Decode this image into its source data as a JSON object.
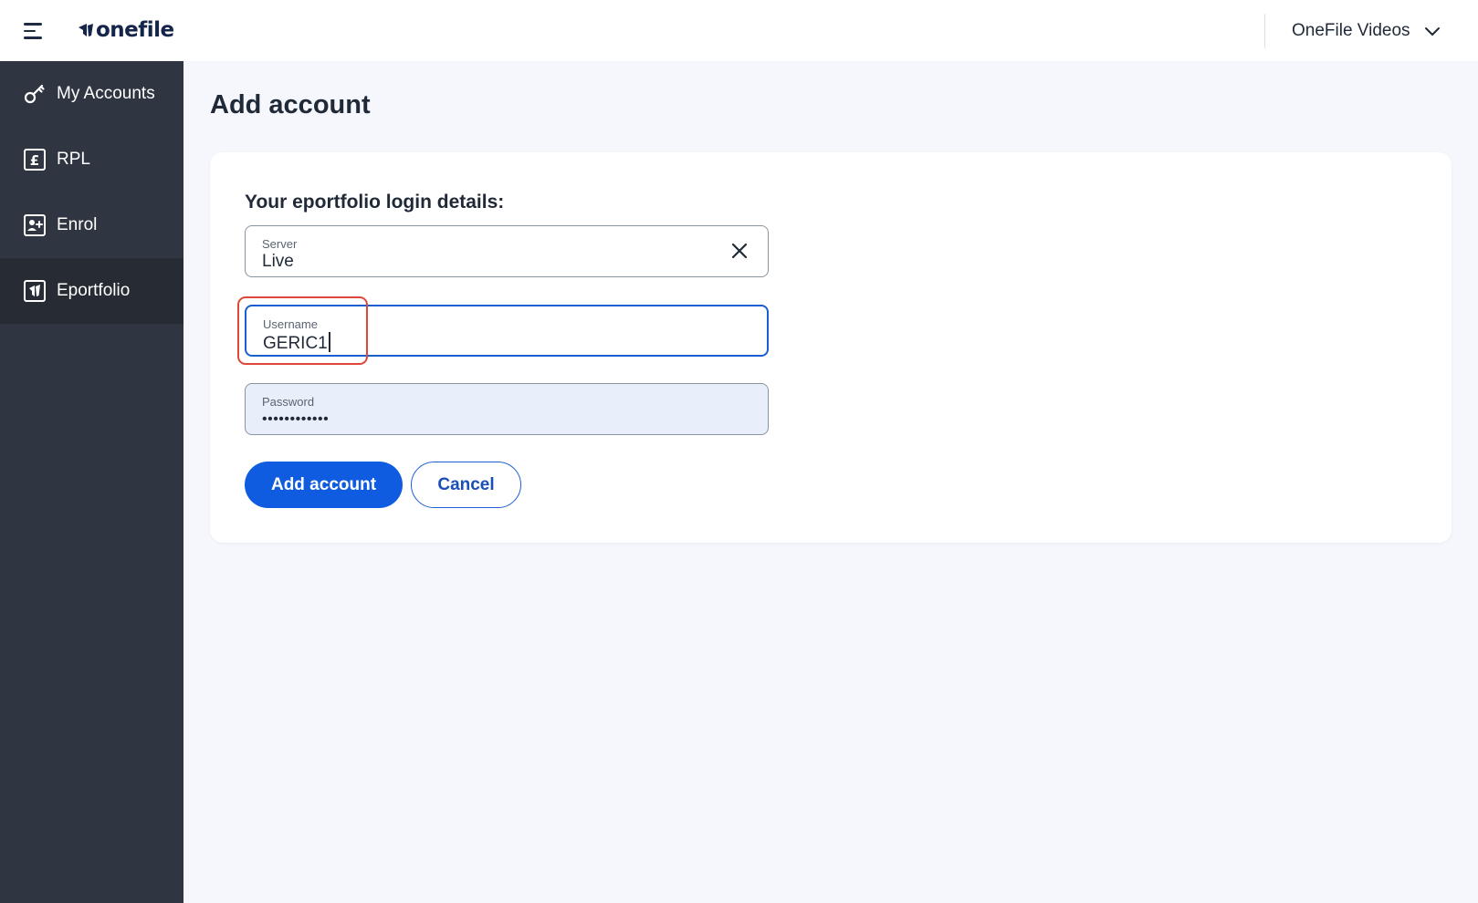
{
  "header": {
    "logo_text": "onefile",
    "org_selector": "OneFile Videos"
  },
  "sidebar": {
    "items": [
      {
        "label": "My Accounts",
        "icon": "key-icon",
        "active": false
      },
      {
        "label": "RPL",
        "icon": "pound-icon",
        "active": false
      },
      {
        "label": "Enrol",
        "icon": "add-user-icon",
        "active": false
      },
      {
        "label": "Eportfolio",
        "icon": "eportfolio-icon",
        "active": true
      }
    ]
  },
  "main": {
    "title": "Add account",
    "form": {
      "heading": "Your eportfolio login details:",
      "server": {
        "label": "Server",
        "value": "Live"
      },
      "username": {
        "label": "Username",
        "value": "GERIC1"
      },
      "password": {
        "label": "Password",
        "value": "••••••••••••"
      },
      "submit_label": "Add account",
      "cancel_label": "Cancel"
    }
  },
  "colors": {
    "sidebar_bg": "#2f3642",
    "sidebar_active": "#262b34",
    "primary": "#0f5ce0",
    "focus_border": "#1b5ed1",
    "annotation": "#e0473a"
  }
}
